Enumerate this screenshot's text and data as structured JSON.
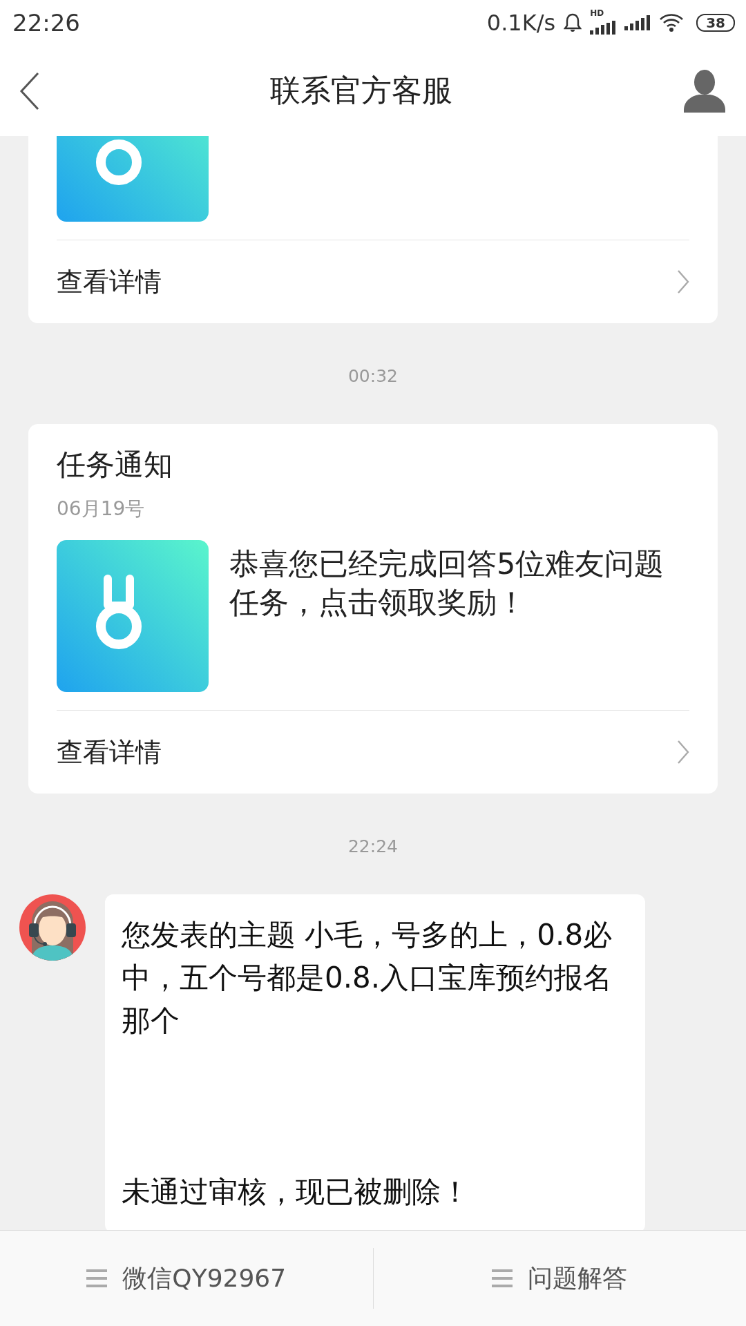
{
  "status_bar": {
    "time": "22:26",
    "speed": "0.1K/s",
    "network_label": "HD",
    "battery": "38"
  },
  "header": {
    "title": "联系官方客服"
  },
  "messages": [
    {
      "kind": "card",
      "cut_off": true,
      "link": "查看详情"
    },
    {
      "kind": "time",
      "text": "00:32"
    },
    {
      "kind": "card",
      "cut_off": false,
      "title": "任务通知",
      "date": "06月19号",
      "body": "恭喜您已经完成回答5位难友问题任务，点击领取奖励！",
      "link": "查看详情"
    },
    {
      "kind": "time",
      "text": "22:24"
    },
    {
      "kind": "bubble",
      "paragraphs": [
        "您发表的主题 小毛，号多的上，0.8必中，五个号都是0.8.入口宝库预约报名那个",
        "未通过审核，现已被删除！"
      ]
    }
  ],
  "bottom_menu": [
    {
      "label": "微信QY92967"
    },
    {
      "label": "问题解答"
    }
  ]
}
